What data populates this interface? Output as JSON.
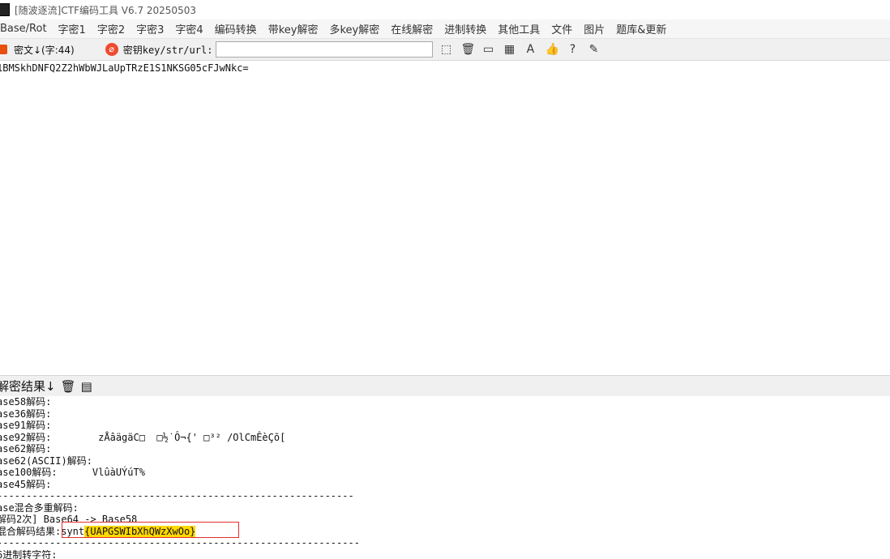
{
  "window": {
    "title": "[随波逐流]CTF编码工具 V6.7  20250503"
  },
  "menu": [
    "Base/Rot",
    "字密1",
    "字密2",
    "字密3",
    "字密4",
    "编码转换",
    "带key解密",
    "多key解密",
    "在线解密",
    "进制转换",
    "其他工具",
    "文件",
    "图片",
    "题库&更新"
  ],
  "toolbar": {
    "cipher_label": "密文↓(字:44)",
    "key_label": "密钥key/str/url:",
    "key_value": "",
    "icons": [
      "select-icon",
      "trash-icon",
      "terminal-icon",
      "calculator-icon",
      "font-icon",
      "like-icon",
      "help-icon",
      "edit-icon"
    ]
  },
  "editor": {
    "text": "1BMSkhDNFQ2Z2hWbWJLaUpTRzE1S1NKSG05cFJwNkc="
  },
  "result": {
    "header": "解密结果↓",
    "lines": [
      "ase58解码:",
      "ase36解码:",
      "ase91解码:",
      "ase92解码:        zÅâägäC□  □½˙Ô¬{' □³² /OlCmÊèÇõ[",
      "ase62解码:",
      "ase62(ASCII)解码:",
      "ase100解码:      VlûàUÝúT%",
      "ase45解码:",
      "-------------------------------------------------------------",
      "ase混合多重解码:",
      "解码2次] Base64 -> Base58",
      "混合解码结果:",
      "--------------------------------------------------------------",
      "6进制转字符:"
    ],
    "mixed_result_prefix": "synt",
    "mixed_result_flag": "{UAPGSWIbXhQWzXwOo}"
  }
}
